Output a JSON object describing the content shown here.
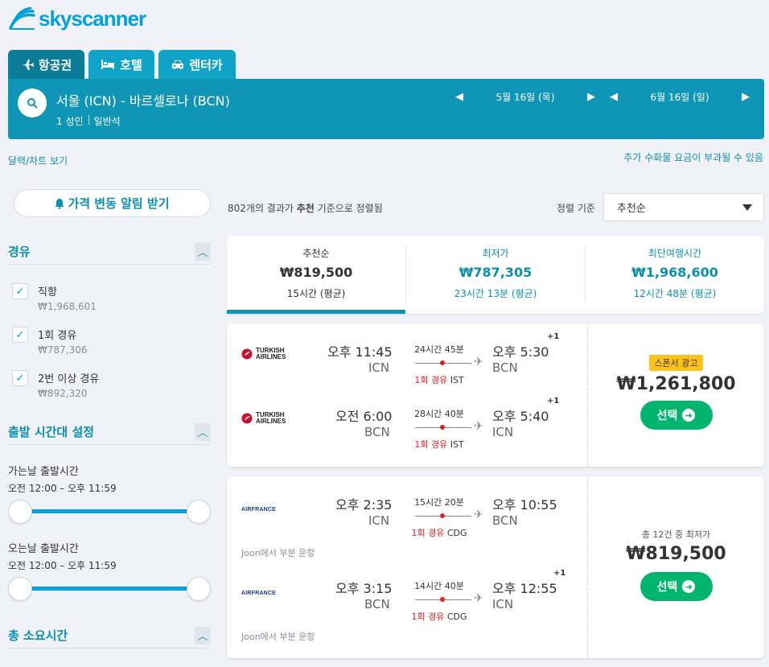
{
  "brand": {
    "name": "skyscanner",
    "color": "#00a1de"
  },
  "tabs": [
    {
      "label": "항공권",
      "icon": "plane-icon"
    },
    {
      "label": "호텔",
      "icon": "bed-icon"
    },
    {
      "label": "렌터카",
      "icon": "car-icon"
    }
  ],
  "search": {
    "route": "서울 (ICN) - 바르셀로나 (BCN)",
    "passengers": "1 성인",
    "cabin": "일반석",
    "depart_date": "5월 16일 (목)",
    "return_date": "6월 16일 (일)"
  },
  "links": {
    "calendar": "달력/차트 보기",
    "fees": "추가 수화물 요금이 부과될 수 있음"
  },
  "sidebar": {
    "alert_button": "가격 변동 알림 받기",
    "stops": {
      "title": "경유",
      "options": [
        {
          "label": "직항",
          "price": "₩1,968,601",
          "checked": true
        },
        {
          "label": "1회 경유",
          "price": "₩787,306",
          "checked": true
        },
        {
          "label": "2번 이상 경유",
          "price": "₩892,320",
          "checked": true
        }
      ]
    },
    "times": {
      "title": "출발 시간대 설정",
      "outbound_label": "가는날 출발시간",
      "outbound_range": "오전 12:00 – 오후 11:59",
      "return_label": "오는날 출발시간",
      "return_range": "오전 12:00 – 오후 11:59"
    },
    "duration": {
      "title": "총 소요시간"
    }
  },
  "results": {
    "count": "802",
    "count_suffix_1": "개의 결과가 ",
    "sort_word": "추천",
    "count_suffix_2": " 기준으로 정렬됨",
    "sort_label": "정렬 기준",
    "sort_value": "추천순"
  },
  "summary": [
    {
      "title": "추천순",
      "price": "₩819,500",
      "duration": "15시간 (평균)"
    },
    {
      "title": "최저가",
      "price": "₩787,305",
      "duration": "23시간 13분 (평균)"
    },
    {
      "title": "최단여행시간",
      "price": "₩1,968,600",
      "duration": "12시간 48분 (평균)"
    }
  ],
  "cards": [
    {
      "airline": "TURKISH AIRLINES",
      "legs": [
        {
          "dep_time": "오후 11:45",
          "dep_code": "ICN",
          "arr_time": "오후 5:30",
          "arr_code": "BCN",
          "plus": "+1",
          "duration": "24시간 45분",
          "stops": "1회 경유",
          "via": "IST"
        },
        {
          "dep_time": "오전 6:00",
          "dep_code": "BCN",
          "arr_time": "오후 5:40",
          "arr_code": "ICN",
          "plus": "+1",
          "duration": "28시간 40분",
          "stops": "1회 경유",
          "via": "IST"
        }
      ],
      "badge": "스폰서 광고",
      "price": "₩1,261,800",
      "button": "선택"
    },
    {
      "airline": "AIRFRANCE",
      "legs": [
        {
          "dep_time": "오후 2:35",
          "dep_code": "ICN",
          "arr_time": "오후 10:55",
          "arr_code": "BCN",
          "plus": "",
          "duration": "15시간 20분",
          "stops": "1회 경유",
          "via": "CDG",
          "note": "Joon에서 부분 운항"
        },
        {
          "dep_time": "오후 3:15",
          "dep_code": "BCN",
          "arr_time": "오후 12:55",
          "arr_code": "ICN",
          "plus": "+1",
          "duration": "14시간 40분",
          "stops": "1회 경유",
          "via": "CDG",
          "note": "Joon에서 부분 운항"
        }
      ],
      "deals": "총 12건 중 최저가",
      "price": "₩819,500",
      "button": "선택"
    }
  ]
}
